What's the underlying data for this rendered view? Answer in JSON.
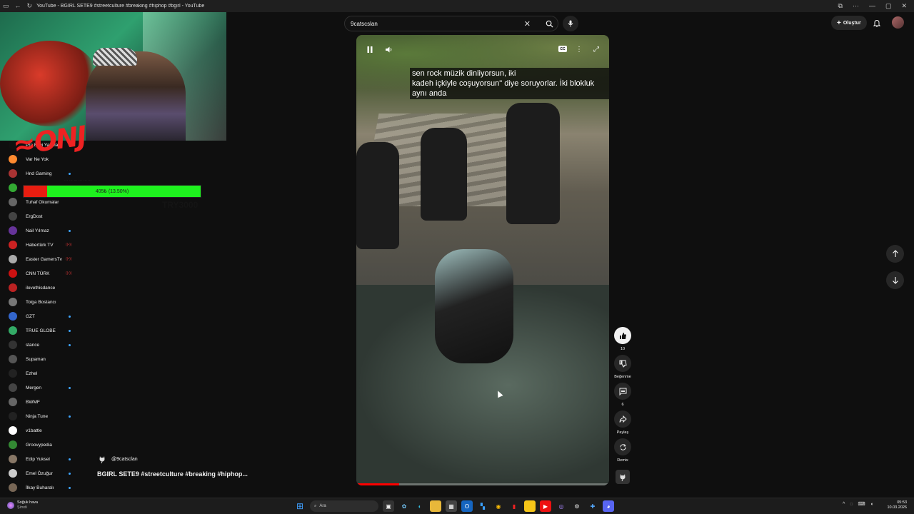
{
  "window": {
    "title": "YouTube - BGIRL SETE9 #streetculture #breaking #hiphop #bgirl - YouTube",
    "controls": [
      "—",
      "▢",
      "✕"
    ]
  },
  "header": {
    "search_value": "9catscslan",
    "create_label": "Oluştur"
  },
  "stream_overlay": {
    "progress_text": "405₺ (13.50%)",
    "progress_fraction": 0.135,
    "goal_text": "TRY3000",
    "ghost_text": "... ... ... ... ... ...",
    "colors": {
      "bar": "#1ef21e",
      "fill": "#e81d10"
    }
  },
  "sidebar": {
    "items": [
      {
        "name": "Pro Bilgi Yaynlar",
        "color": "#111",
        "mark": "dot"
      },
      {
        "name": "Var Ne Yok",
        "color": "#ff8a30",
        "mark": ""
      },
      {
        "name": "Hnd Gaming",
        "color": "#a33",
        "mark": "dot"
      },
      {
        "name": "",
        "color": "#3a3",
        "mark": ""
      },
      {
        "name": "Tuhaf Okumalar",
        "color": "#666",
        "mark": ""
      },
      {
        "name": "ErgDost",
        "color": "#444",
        "mark": ""
      },
      {
        "name": "Nail Yılmaz",
        "color": "#639",
        "mark": "dot"
      },
      {
        "name": "Habertürk TV",
        "color": "#c22",
        "mark": "live"
      },
      {
        "name": "Easter GamersTv",
        "color": "#aaa",
        "mark": "live"
      },
      {
        "name": "CNN TÜRK",
        "color": "#c11",
        "mark": "live"
      },
      {
        "name": "ilovethisdance",
        "color": "#b22",
        "mark": ""
      },
      {
        "name": "Tolga Bostancı",
        "color": "#777",
        "mark": ""
      },
      {
        "name": "GZT",
        "color": "#36c",
        "mark": "dot"
      },
      {
        "name": "TRUE GLOBE",
        "color": "#3a6",
        "mark": "dot"
      },
      {
        "name": "stance",
        "color": "#333",
        "mark": "dot"
      },
      {
        "name": "Supaman",
        "color": "#555",
        "mark": ""
      },
      {
        "name": "Ezhel",
        "color": "#222",
        "mark": ""
      },
      {
        "name": "Mergen",
        "color": "#444",
        "mark": "dot"
      },
      {
        "name": "BWMF",
        "color": "#666",
        "mark": ""
      },
      {
        "name": "Ninja Tune",
        "color": "#222",
        "mark": "dot"
      },
      {
        "name": "v1battle",
        "color": "#fff",
        "mark": ""
      },
      {
        "name": "Groovypedia",
        "color": "#383",
        "mark": ""
      },
      {
        "name": "Edip Yuksel",
        "color": "#876",
        "mark": "dot"
      },
      {
        "name": "Emel Özuğur",
        "color": "#ccc",
        "mark": "dot"
      },
      {
        "name": "İlkay Buharalı",
        "color": "#765",
        "mark": "dot"
      }
    ]
  },
  "video": {
    "caption_lines": [
      "sen rock müzik dinliyorsun, iki",
      "kadeh içkiyle coşuyorsun\" diye soruyorlar.  İki blokluk",
      "aynı anda"
    ],
    "cc_label": "CC",
    "progress_fraction": 0.17,
    "channel": "@9catsclan",
    "title": "BGIRL SETE9  #streetculture #breaking #hiphop..."
  },
  "actions": {
    "like_count": "10",
    "dislike_label": "Beğenme",
    "comments_count": "6",
    "share_label": "Paylaş",
    "remix_label": "Remix"
  },
  "taskbar": {
    "weather_line1": "Soğuk hava",
    "weather_line2": "Şimdi",
    "search_placeholder": "Ara",
    "time": "05:53",
    "date": "10.03.2026"
  }
}
